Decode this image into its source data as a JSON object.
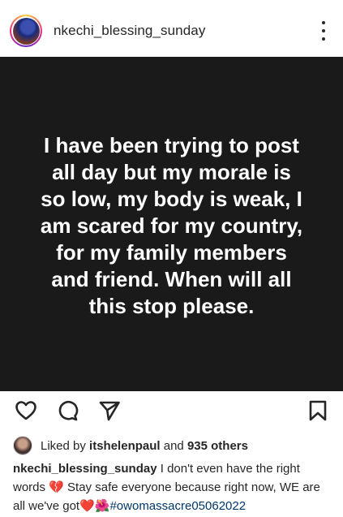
{
  "header": {
    "username": "nkechi_blessing_sunday",
    "more_icon": "more-vertical-icon"
  },
  "post": {
    "text": "I have been trying to post\nall day but my morale is\nso low, my body is weak, I\nam scared for my country,\nfor my family members\nand friend. When will all\nthis stop please."
  },
  "actions": {
    "icons": [
      "heart-icon",
      "comment-icon",
      "share-icon",
      "bookmark-icon"
    ]
  },
  "likes": {
    "prefix": "Liked by",
    "user": "itshelenpaul",
    "and": "and",
    "others": "935 others"
  },
  "caption": {
    "username": "nkechi_blessing_sunday",
    "text1": "I don't even have the right words",
    "emoji1": "💔",
    "text2": "Stay safe everyone because right now, WE are all we've got",
    "emoji2": "❤️",
    "emoji3": "🌺",
    "hashtag": "#owomassacre05062022"
  },
  "colors": {
    "post_bg": "#1a1a1a",
    "hashtag": "#00376b",
    "text": "#262626"
  }
}
